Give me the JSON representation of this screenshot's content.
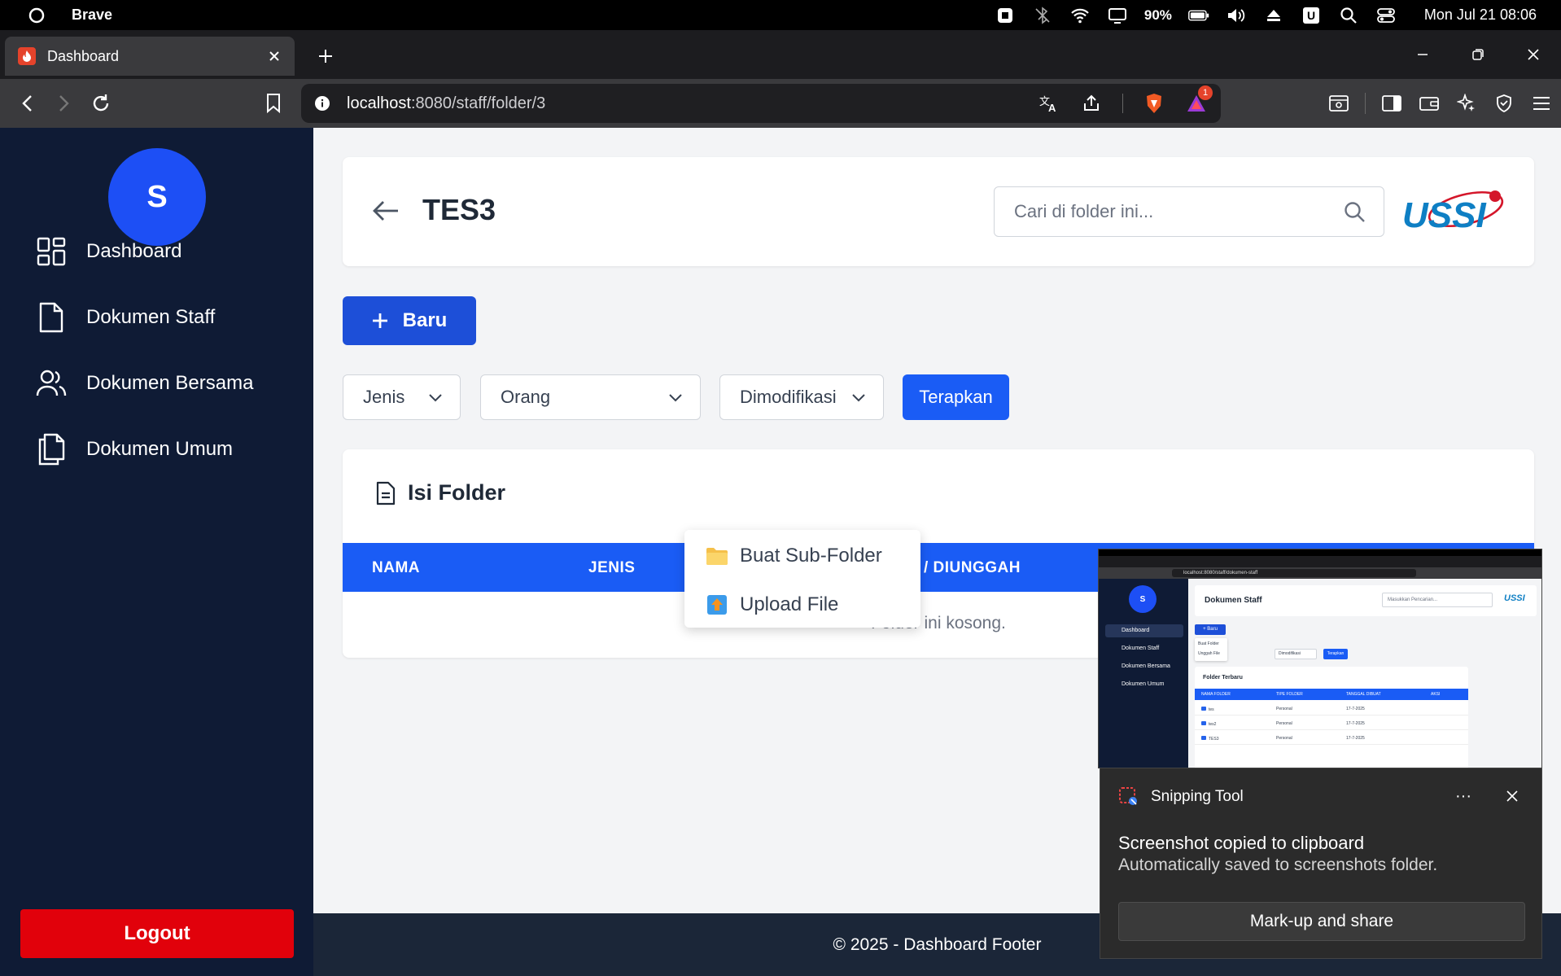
{
  "os": {
    "app_name": "Brave",
    "battery_percent": "90%",
    "clock": "Mon Jul 21 08:06",
    "indicator_letter": "U"
  },
  "browser": {
    "tab_title": "Dashboard",
    "url_host": "localhost",
    "url_path": ":8080/staff/folder/3",
    "notification_count": "1"
  },
  "sidebar": {
    "avatar_initial": "S",
    "items": [
      {
        "label": "Dashboard",
        "icon": "dashboard-grid-icon"
      },
      {
        "label": "Dokumen Staff",
        "icon": "document-icon"
      },
      {
        "label": "Dokumen Bersama",
        "icon": "users-icon"
      },
      {
        "label": "Dokumen Umum",
        "icon": "copy-document-icon"
      }
    ],
    "logout_label": "Logout"
  },
  "header": {
    "title": "TES3",
    "search_placeholder": "Cari di folder ini...",
    "logo_text": "USSI"
  },
  "actions": {
    "new_label": "Baru"
  },
  "filters": {
    "type_label": "Jenis",
    "person_label": "Orang",
    "modified_label": "Dimodifikasi",
    "apply_label": "Terapkan"
  },
  "folder": {
    "heading": "Isi Folder",
    "columns": [
      "NAMA",
      "JENIS",
      "/ DIUNGGAH"
    ],
    "empty_message": "Folder ini kosong."
  },
  "dropdown": {
    "items": [
      {
        "label": "Buat Sub-Folder",
        "icon": "folder-icon"
      },
      {
        "label": "Upload File",
        "icon": "upload-icon"
      }
    ]
  },
  "footer": {
    "text": "© 2025 - Dashboard Footer"
  },
  "toast": {
    "app_name": "Snipping Tool",
    "title": "Screenshot copied to clipboard",
    "subtitle": "Automatically saved to screenshots folder.",
    "button_label": "Mark-up and share",
    "more_label": "···"
  },
  "thumbnail": {
    "url": "localhost:8080/staff/dokumen-staff",
    "avatar_initial": "S",
    "nav": [
      "Dashboard",
      "Dokumen Staff",
      "Dokumen Bersama",
      "Dokumen Umum"
    ],
    "title": "Dokumen Staff",
    "search_placeholder": "Masukkan Pencarian...",
    "logo_text": "USSI",
    "new_label": "+ Baru",
    "menu_items": [
      "Buat Folder",
      "Unggah File"
    ],
    "filter_label": "Dimodifikasi",
    "apply_label": "Terapkan",
    "card_title": "Folder Terbaru",
    "columns": [
      "NAMA FOLDER",
      "TIPE FOLDER",
      "TANGGAL DIBUAT",
      "AKSI"
    ],
    "rows": [
      {
        "name": "tes",
        "type": "Personal",
        "date": "17-7-2025"
      },
      {
        "name": "tes2",
        "type": "Personal",
        "date": "17-7-2025"
      },
      {
        "name": "TES3",
        "type": "Personal",
        "date": "17-7-2025"
      }
    ]
  }
}
